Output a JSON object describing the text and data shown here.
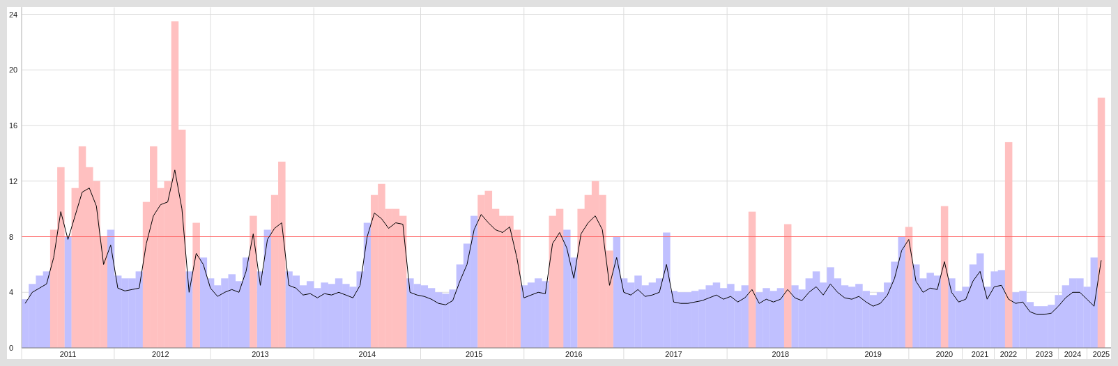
{
  "chart_data": {
    "type": "bar",
    "categories": [
      null,
      null,
      null,
      null,
      null,
      null,
      "2011",
      null,
      null,
      null,
      null,
      null,
      null,
      null,
      null,
      null,
      null,
      null,
      null,
      "2012",
      null,
      null,
      null,
      null,
      null,
      null,
      null,
      null,
      null,
      null,
      null,
      null,
      null,
      "2013",
      null,
      null,
      null,
      null,
      null,
      null,
      null,
      null,
      null,
      null,
      null,
      null,
      null,
      null,
      "2014",
      null,
      null,
      null,
      null,
      null,
      null,
      null,
      null,
      null,
      null,
      null,
      null,
      null,
      null,
      "2015",
      null,
      null,
      null,
      null,
      null,
      null,
      null,
      null,
      null,
      null,
      null,
      null,
      null,
      "2016",
      null,
      null,
      null,
      null,
      null,
      null,
      null,
      null,
      null,
      null,
      null,
      null,
      null,
      "2017",
      null,
      null,
      null,
      null,
      null,
      null,
      null,
      null,
      null,
      null,
      null,
      null,
      null,
      null,
      "2018",
      null,
      null,
      null,
      null,
      null,
      null,
      null,
      null,
      null,
      null,
      null,
      null,
      "2019",
      null,
      null,
      null,
      null,
      null,
      null,
      null,
      null,
      null,
      "2020",
      null,
      null,
      null,
      null,
      "2021",
      null,
      null,
      null,
      "2022",
      null,
      null,
      null,
      null,
      "2023",
      null,
      null,
      null,
      "2024",
      null,
      null,
      null,
      "2025"
    ],
    "ylim": [
      0,
      24
    ],
    "yticks": [
      0,
      4,
      8,
      12,
      16,
      20,
      24
    ],
    "series": [
      {
        "color": "#c0c0ff",
        "values": [
          3.5,
          4.6,
          5.2,
          5.5,
          null,
          null,
          8.0,
          null,
          null,
          null,
          null,
          null,
          8.5,
          5.2,
          5.0,
          5.0,
          5.5,
          null,
          null,
          null,
          null,
          null,
          null,
          5.5,
          null,
          6.5,
          5.0,
          4.5,
          5.0,
          5.3,
          4.8,
          6.5,
          null,
          5.5,
          8.5,
          null,
          null,
          5.5,
          5.2,
          4.5,
          4.8,
          4.3,
          4.7,
          4.6,
          5.0,
          4.6,
          4.4,
          5.5,
          9,
          null,
          null,
          null,
          null,
          null,
          5.0,
          4.6,
          4.5,
          4.3,
          4.0,
          3.9,
          4.2,
          6.0,
          7.5,
          9.5,
          null,
          null,
          null,
          null,
          null,
          null,
          4.5,
          4.7,
          5.0,
          4.8,
          null,
          null,
          8.5,
          6.5,
          null,
          null,
          null,
          null,
          null,
          8,
          5.0,
          4.7,
          5.2,
          4.5,
          4.7,
          5.0,
          8.3,
          4.1,
          4.0,
          4.0,
          4.1,
          4.2,
          4.5,
          4.7,
          4.3,
          4.6,
          4.1,
          4.5,
          null,
          4.0,
          4.3,
          4.1,
          4.3,
          null,
          4.5,
          4.2,
          5.0,
          5.5,
          4.7,
          5.8,
          5.0,
          4.5,
          4.4,
          4.6,
          4.1,
          3.8,
          4.0,
          4.7,
          6.2,
          8.0,
          null,
          6.0,
          5.0,
          5.4,
          5.2,
          null,
          5.0,
          4.1,
          4.4,
          6.0,
          6.8,
          4.4,
          5.5,
          5.6,
          null,
          4.0,
          4.1,
          3.3,
          3.0,
          3.0,
          3.1,
          3.8,
          4.5,
          5.0,
          5.0,
          4.4,
          6.5,
          null
        ]
      },
      {
        "color": "#ffc0c0",
        "values": [
          null,
          null,
          null,
          null,
          8.5,
          13,
          null,
          11.5,
          14.5,
          13,
          12,
          8,
          null,
          null,
          null,
          null,
          null,
          10.5,
          14.5,
          11.5,
          12,
          23.5,
          15.7,
          null,
          9,
          null,
          null,
          null,
          null,
          null,
          null,
          null,
          9.5,
          null,
          null,
          11,
          13.4,
          null,
          null,
          null,
          null,
          null,
          null,
          null,
          null,
          null,
          null,
          null,
          null,
          11,
          11.8,
          10,
          10,
          9.5,
          null,
          null,
          null,
          null,
          null,
          null,
          null,
          null,
          null,
          null,
          11,
          11.3,
          10,
          9.5,
          9.5,
          8.5,
          null,
          null,
          null,
          null,
          9.5,
          10,
          null,
          null,
          10,
          11,
          12,
          11,
          7,
          null,
          null,
          null,
          null,
          null,
          null,
          null,
          null,
          null,
          null,
          null,
          null,
          null,
          null,
          null,
          null,
          null,
          null,
          null,
          9.8,
          null,
          null,
          null,
          null,
          8.9,
          null,
          null,
          null,
          null,
          null,
          null,
          null,
          null,
          null,
          null,
          null,
          null,
          null,
          null,
          null,
          null,
          8.7,
          null,
          null,
          null,
          null,
          10.2,
          null,
          null,
          null,
          null,
          null,
          null,
          null,
          null,
          14.8,
          null,
          null,
          null,
          null,
          null,
          null,
          null,
          null,
          null,
          null,
          null,
          null,
          18
        ]
      },
      {
        "type": "line",
        "color": "#000000",
        "values": [
          3.2,
          4.0,
          4.3,
          4.6,
          6.5,
          9.8,
          7.8,
          9.5,
          11.2,
          11.5,
          10.2,
          6.0,
          7.4,
          4.3,
          4.1,
          4.2,
          4.3,
          7.5,
          9.5,
          10.3,
          10.5,
          12.8,
          10.0,
          4.0,
          6.8,
          6.0,
          4.3,
          3.7,
          4.0,
          4.2,
          4.0,
          5.5,
          8.2,
          4.5,
          7.8,
          8.6,
          9.0,
          4.5,
          4.3,
          3.8,
          3.9,
          3.6,
          3.9,
          3.8,
          4.0,
          3.8,
          3.6,
          4.5,
          8.0,
          9.7,
          9.3,
          8.6,
          9.0,
          8.9,
          4.0,
          3.8,
          3.7,
          3.5,
          3.2,
          3.1,
          3.4,
          4.8,
          6.0,
          8.5,
          9.6,
          9.0,
          8.5,
          8.3,
          8.7,
          6.5,
          3.6,
          3.8,
          4.0,
          3.9,
          7.5,
          8.3,
          7.2,
          5.0,
          8.2,
          9.0,
          9.5,
          8.5,
          4.5,
          6.5,
          4.0,
          3.8,
          4.2,
          3.7,
          3.8,
          4.0,
          6.0,
          3.3,
          3.2,
          3.2,
          3.3,
          3.4,
          3.6,
          3.8,
          3.5,
          3.7,
          3.3,
          3.6,
          4.2,
          3.2,
          3.5,
          3.3,
          3.5,
          4.2,
          3.6,
          3.4,
          4.0,
          4.4,
          3.8,
          4.6,
          4.0,
          3.6,
          3.5,
          3.7,
          3.3,
          3.0,
          3.2,
          3.8,
          5.0,
          7.0,
          7.8,
          4.8,
          4.0,
          4.3,
          4.2,
          6.2,
          4.0,
          3.3,
          3.5,
          4.8,
          5.5,
          3.5,
          4.4,
          4.5,
          3.5,
          3.2,
          3.3,
          2.6,
          2.4,
          2.4,
          2.5,
          3.0,
          3.6,
          4.0,
          4.0,
          3.5,
          3.0,
          6.3
        ]
      }
    ],
    "grid": true,
    "ref_lines": [
      {
        "axis": "y",
        "value": 8
      }
    ]
  }
}
